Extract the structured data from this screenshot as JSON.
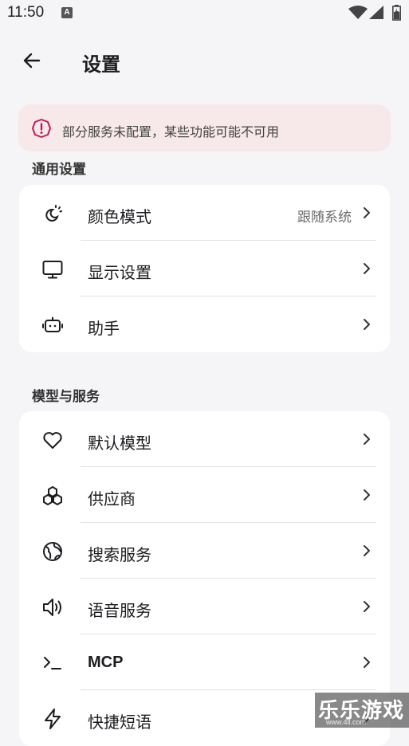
{
  "status_bar": {
    "time": "11:50",
    "notification_glyph": "A"
  },
  "app_bar": {
    "title": "设置"
  },
  "warning": {
    "text": "部分服务未配置，某些功能可能不可用",
    "color": "#c2185b"
  },
  "general": {
    "title": "通用设置",
    "items": [
      {
        "icon": "color-mode-icon",
        "label": "颜色模式",
        "value": "跟随系统"
      },
      {
        "icon": "monitor-icon",
        "label": "显示设置"
      },
      {
        "icon": "robot-icon",
        "label": "助手"
      }
    ]
  },
  "models": {
    "title": "模型与服务",
    "items": [
      {
        "icon": "heart-icon",
        "label": "默认模型"
      },
      {
        "icon": "boxes-icon",
        "label": "供应商"
      },
      {
        "icon": "globe-icon",
        "label": "搜索服务"
      },
      {
        "icon": "speaker-icon",
        "label": "语音服务"
      },
      {
        "icon": "terminal-icon",
        "label": "MCP"
      },
      {
        "icon": "lightning-icon",
        "label": "快捷短语"
      }
    ]
  },
  "watermark": {
    "main": "乐乐游戏",
    "sub": "www.4ll.com"
  }
}
